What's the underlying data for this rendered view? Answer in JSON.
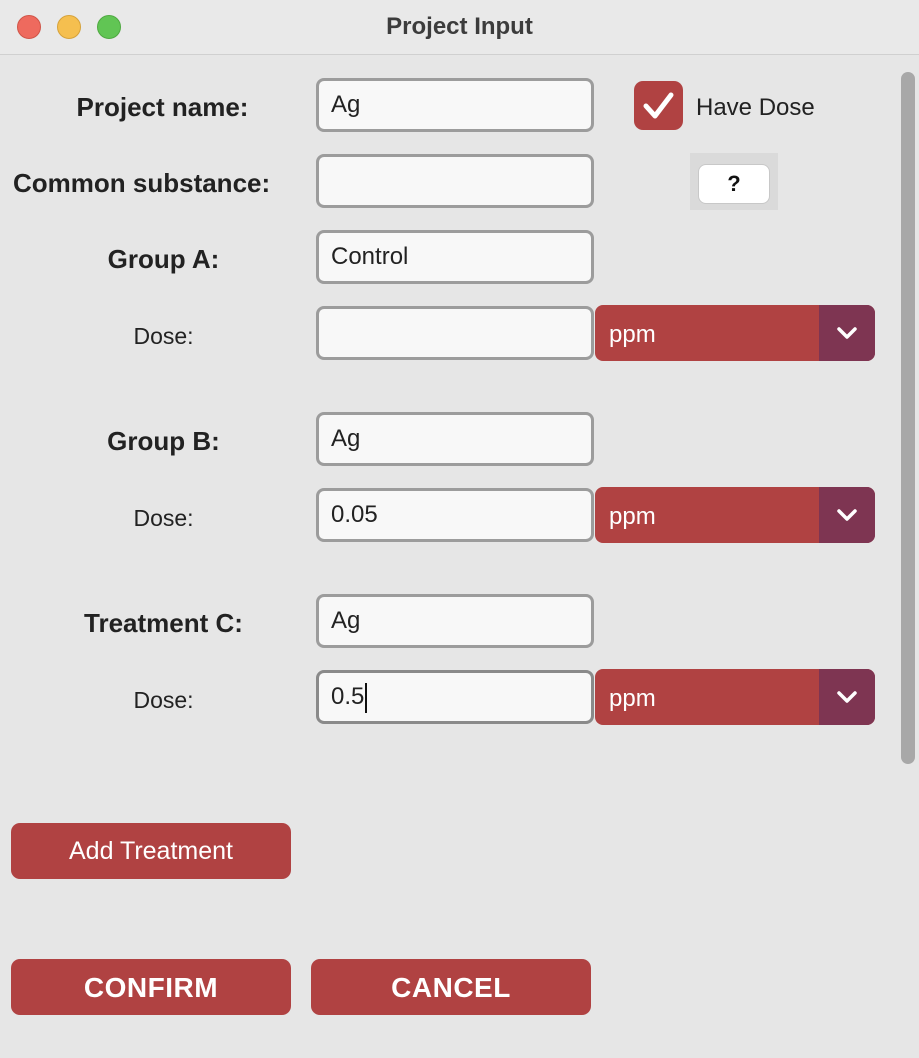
{
  "window": {
    "title": "Project Input"
  },
  "project_name": {
    "label": "Project name:",
    "value": "Ag"
  },
  "have_dose": {
    "label": "Have Dose",
    "checked": true
  },
  "common_substance": {
    "label": "Common substance:",
    "value": ""
  },
  "help_button": {
    "label": "?"
  },
  "group_a": {
    "label": "Group A:",
    "value": "Control",
    "dose_label": "Dose:",
    "dose_value": "",
    "unit": "ppm"
  },
  "group_b": {
    "label": "Group B:",
    "value": "Ag",
    "dose_label": "Dose:",
    "dose_value": "0.05",
    "unit": "ppm"
  },
  "treatment_c": {
    "label": "Treatment C:",
    "value": "Ag",
    "dose_label": "Dose:",
    "dose_value": "0.5",
    "unit": "ppm"
  },
  "buttons": {
    "add_treatment": "Add Treatment",
    "confirm": "CONFIRM",
    "cancel": "CANCEL"
  },
  "colors": {
    "accent": "#b04242",
    "select_arrow": "#7e3552",
    "window_background": "#e6e6e6"
  }
}
